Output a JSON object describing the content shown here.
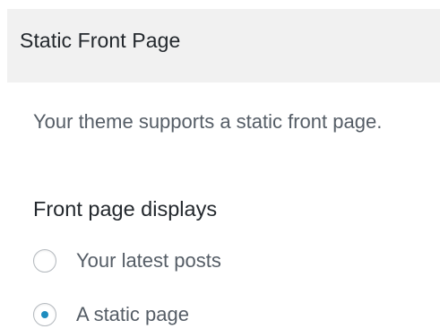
{
  "section": {
    "title": "Static Front Page"
  },
  "description": "Your theme supports a static front page.",
  "front_page": {
    "label": "Front page displays",
    "options": [
      {
        "label": "Your latest posts",
        "checked": false
      },
      {
        "label": "A static page",
        "checked": true
      }
    ]
  },
  "colors": {
    "header_bg": "#f1f1f1",
    "radio_checked": "#1e8cbe"
  }
}
